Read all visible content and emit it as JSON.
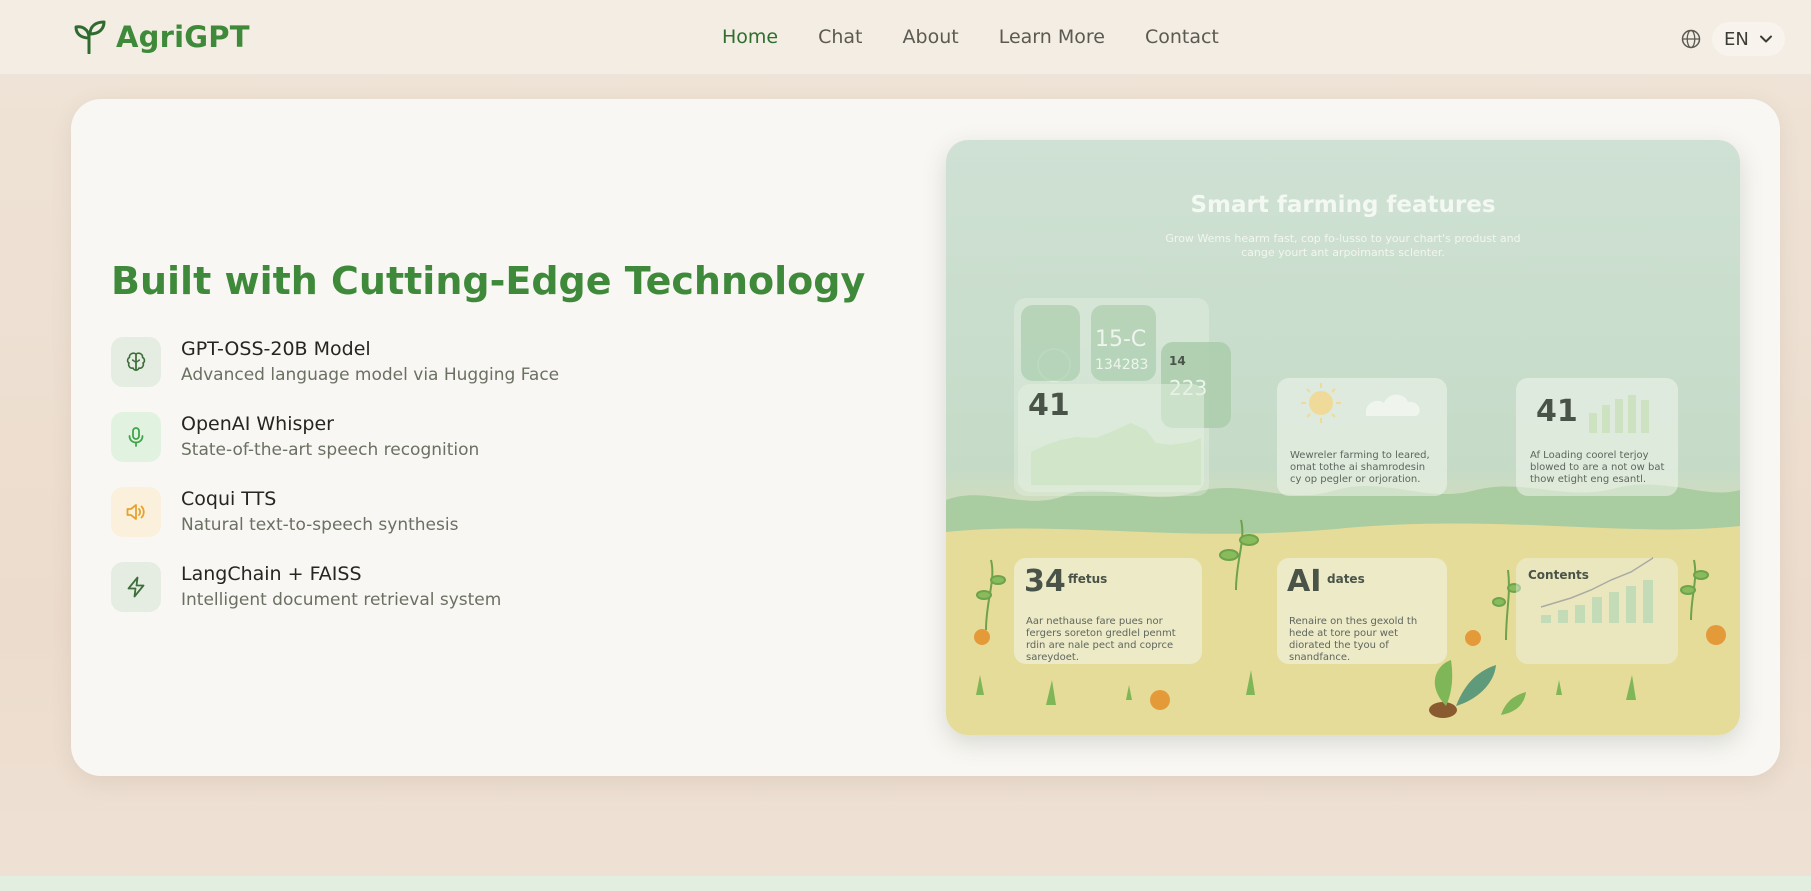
{
  "header": {
    "brand": "AgriGPT",
    "nav": [
      "Home",
      "Chat",
      "About",
      "Learn More",
      "Contact"
    ],
    "active_nav": "Home",
    "language": "EN"
  },
  "hero": {
    "title": "Built with Cutting-Edge Technology",
    "features": [
      {
        "name": "GPT-OSS-20B Model",
        "description": "Advanced language model via Hugging Face",
        "icon": "brain-icon",
        "color": "#3e6e3b"
      },
      {
        "name": "OpenAI Whisper",
        "description": "State-of-the-art speech recognition",
        "icon": "microphone-icon",
        "color": "#3fa44a"
      },
      {
        "name": "Coqui TTS",
        "description": "Natural text-to-speech synthesis",
        "icon": "speaker-icon",
        "color": "#e6a22a"
      },
      {
        "name": "LangChain + FAISS",
        "description": "Intelligent document retrieval system",
        "icon": "lightning-icon",
        "color": "#3e6e3b"
      }
    ]
  },
  "illustration": {
    "title": "Smart farming features",
    "subtitle": "Grow Wems hearm fast, cop fo-lusso to your chart's produst and cange yourt ant arpoimants sclenter.",
    "cards": {
      "dash_a_num": "41",
      "dash_temp": "15-C",
      "dash_reading": "134283",
      "dash_small": "14",
      "dash_small2": "223",
      "weather_text": "Wewreler farming to leared, omat tothe ai shamrodesin cy op pegler or orjoration.",
      "chart_num": "41",
      "chart_text": "Af Loading coorel terjoy blowed to are a not ow bat thow etight eng esantl.",
      "status_num": "34",
      "status_label": "ffetus",
      "status_text": "Aar nethause fare pues nor fergers soreton gredlel penmt rdin are nale pect and coprce sareydoet.",
      "ai_num": "AI",
      "ai_label": "dates",
      "ai_text": "Renaire on thes gexold th hede at tore pour wet diorated the tyou of snandfance.",
      "contents_label": "Contents"
    }
  }
}
